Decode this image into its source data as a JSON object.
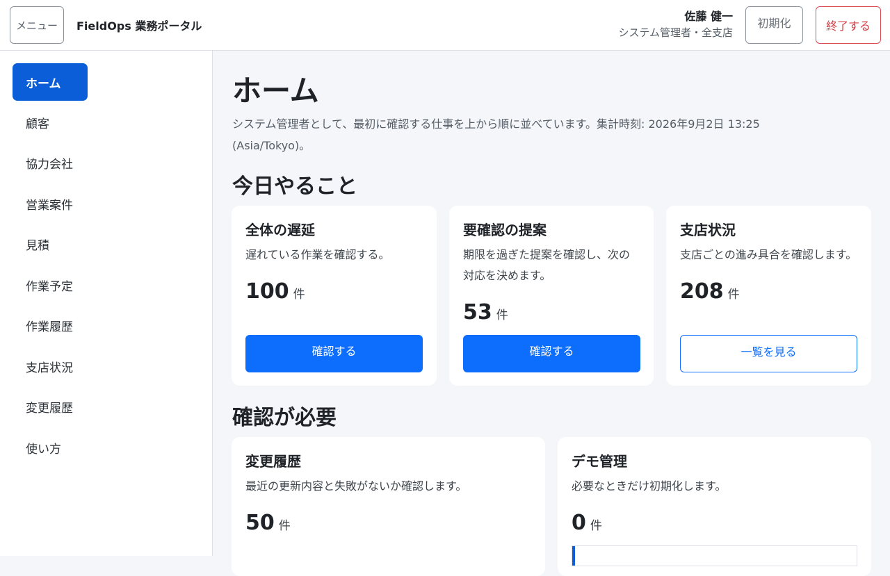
{
  "header": {
    "menu_label": "メニュー",
    "app_title": "FieldOps 業務ポータル",
    "user_name": "佐藤 健一",
    "user_role": "システム管理者・全支店",
    "reset_label": "初期化",
    "logout_label": "終了する"
  },
  "sidebar": {
    "items": [
      {
        "label": "ホーム",
        "active": true
      },
      {
        "label": "顧客"
      },
      {
        "label": "協力会社"
      },
      {
        "label": "営業案件"
      },
      {
        "label": "見積"
      },
      {
        "label": "作業予定"
      },
      {
        "label": "作業履歴"
      },
      {
        "label": "支店状況"
      },
      {
        "label": "変更履歴"
      },
      {
        "label": "使い方"
      }
    ]
  },
  "main": {
    "title": "ホーム",
    "description": "システム管理者として、最初に確認する仕事を上から順に並べています。集計時刻: 2026年9月2日 13:25 (Asia/Tokyo)。",
    "sections": [
      {
        "title": "今日やること",
        "cards": [
          {
            "title": "全体の遅延",
            "desc": "遅れている作業を確認する。",
            "count": "100",
            "unit": "件",
            "button": "確認する"
          },
          {
            "title": "要確認の提案",
            "desc": "期限を過ぎた提案を確認し、次の対応を決めます。",
            "count": "53",
            "unit": "件",
            "button": "確認する"
          },
          {
            "title": "支店状況",
            "desc": "支店ごとの進み具合を確認します。",
            "count": "208",
            "unit": "件",
            "button": "一覧を見る"
          }
        ]
      },
      {
        "title": "確認が必要",
        "cards": [
          {
            "title": "変更履歴",
            "desc": "最近の更新内容と失敗がないか確認します。",
            "count": "50",
            "unit": "件"
          },
          {
            "title": "デモ管理",
            "desc": "必要なときだけ初期化します。",
            "count": "0",
            "unit": "件",
            "progress": 0
          }
        ]
      }
    ]
  },
  "colors": {
    "accent": "#0d6efd",
    "active_nav": "#0b5ed7",
    "danger": "#d63a41",
    "page_bg": "#f4f6fa"
  }
}
